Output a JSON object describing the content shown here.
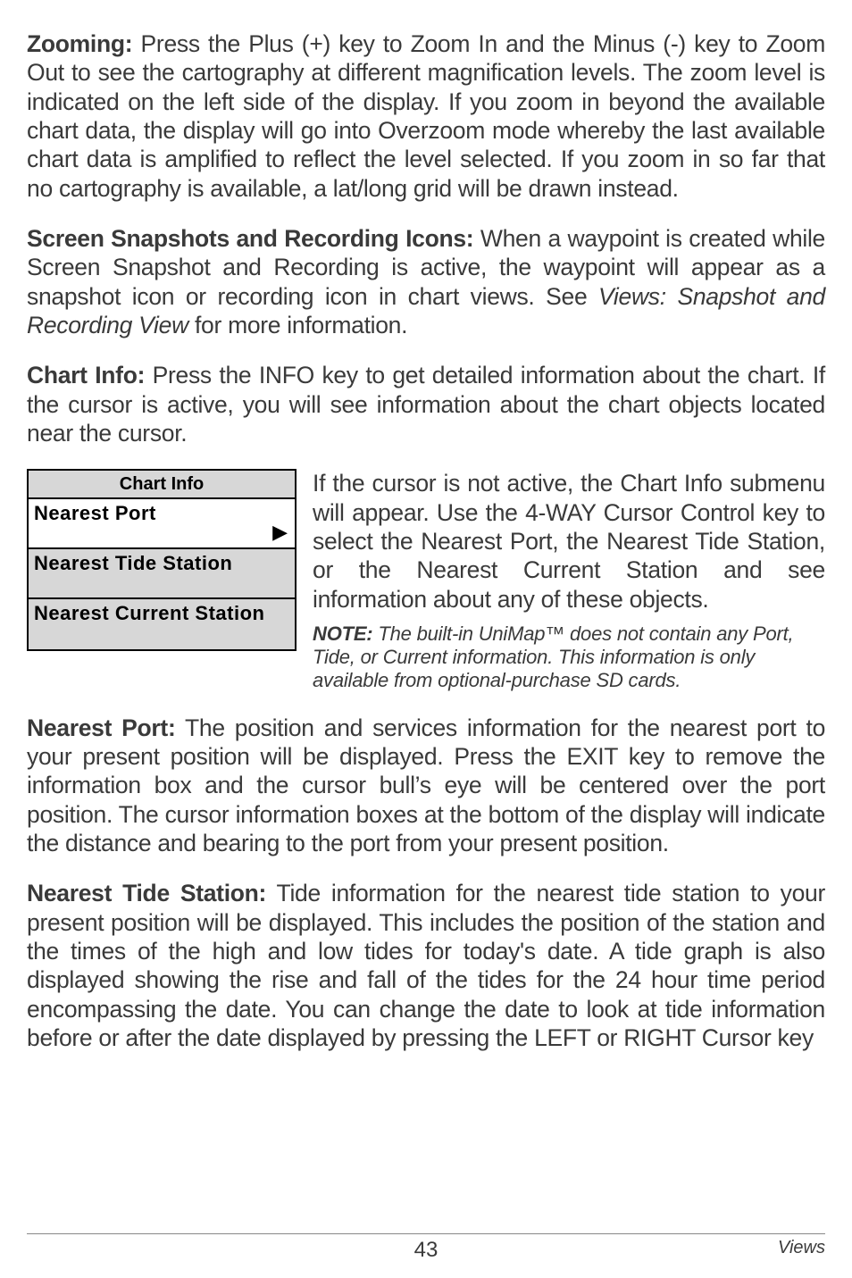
{
  "para1": {
    "lead": "Zooming:",
    "body": " Press the Plus (+) key to Zoom In and the Minus (-) key to Zoom Out to see the cartography at different magnification levels. The zoom level is indicated on the left side of the display. If you zoom in beyond the available chart data, the display will go into Overzoom mode whereby the last available chart data is amplified to reflect the level selected. If you zoom in so far that no cartography is available, a lat/long grid will be drawn instead."
  },
  "para2": {
    "lead": "Screen Snapshots and Recording Icons:",
    "body1": " When a waypoint is created while Screen Snapshot and Recording is active, the waypoint will appear as a snapshot icon or recording icon in chart views. See ",
    "italic": "Views: Snapshot and Recording View",
    "body2": " for more information."
  },
  "para3": {
    "lead": "Chart Info:",
    "body": " Press the INFO key to get detailed information about the chart. If the cursor is active, you will see information about the chart objects located near the cursor."
  },
  "menu": {
    "title": "Chart Info",
    "items": [
      {
        "label": "Nearest Port",
        "selected": true
      },
      {
        "label": "Nearest Tide Station",
        "selected": false
      },
      {
        "label": "Nearest Current Station",
        "selected": false
      }
    ]
  },
  "rightCol": {
    "body": "If the cursor is not active, the Chart Info submenu will appear. Use the 4-WAY Cursor Control key to select the Nearest Port, the Nearest Tide Station, or the Nearest Current Station and see information about any of these objects.",
    "noteLabel": "NOTE:",
    "noteBody": " The built-in UniMap™ does not contain any Port, Tide, or Current information. This information is only available from optional-purchase SD cards."
  },
  "para4": {
    "lead": "Nearest Port:",
    "body": " The position and services information for the nearest port to your present position will be displayed. Press the EXIT key to remove the information box and the cursor bull’s eye will be centered over the port position. The cursor information boxes at the bottom of the display will indicate the distance and bearing to the port from your present position."
  },
  "para5": {
    "lead": "Nearest Tide Station:",
    "body": " Tide information for the nearest tide station to your present position will be displayed. This includes the position of the station and the times of the high and low tides for today's date. A tide graph is also displayed showing the rise and fall of the tides for the 24 hour time period encompassing the date. You can change the date to look at tide information before or after the date displayed by pressing the LEFT or RIGHT Cursor key"
  },
  "footer": {
    "pageNum": "43",
    "section": "Views"
  }
}
